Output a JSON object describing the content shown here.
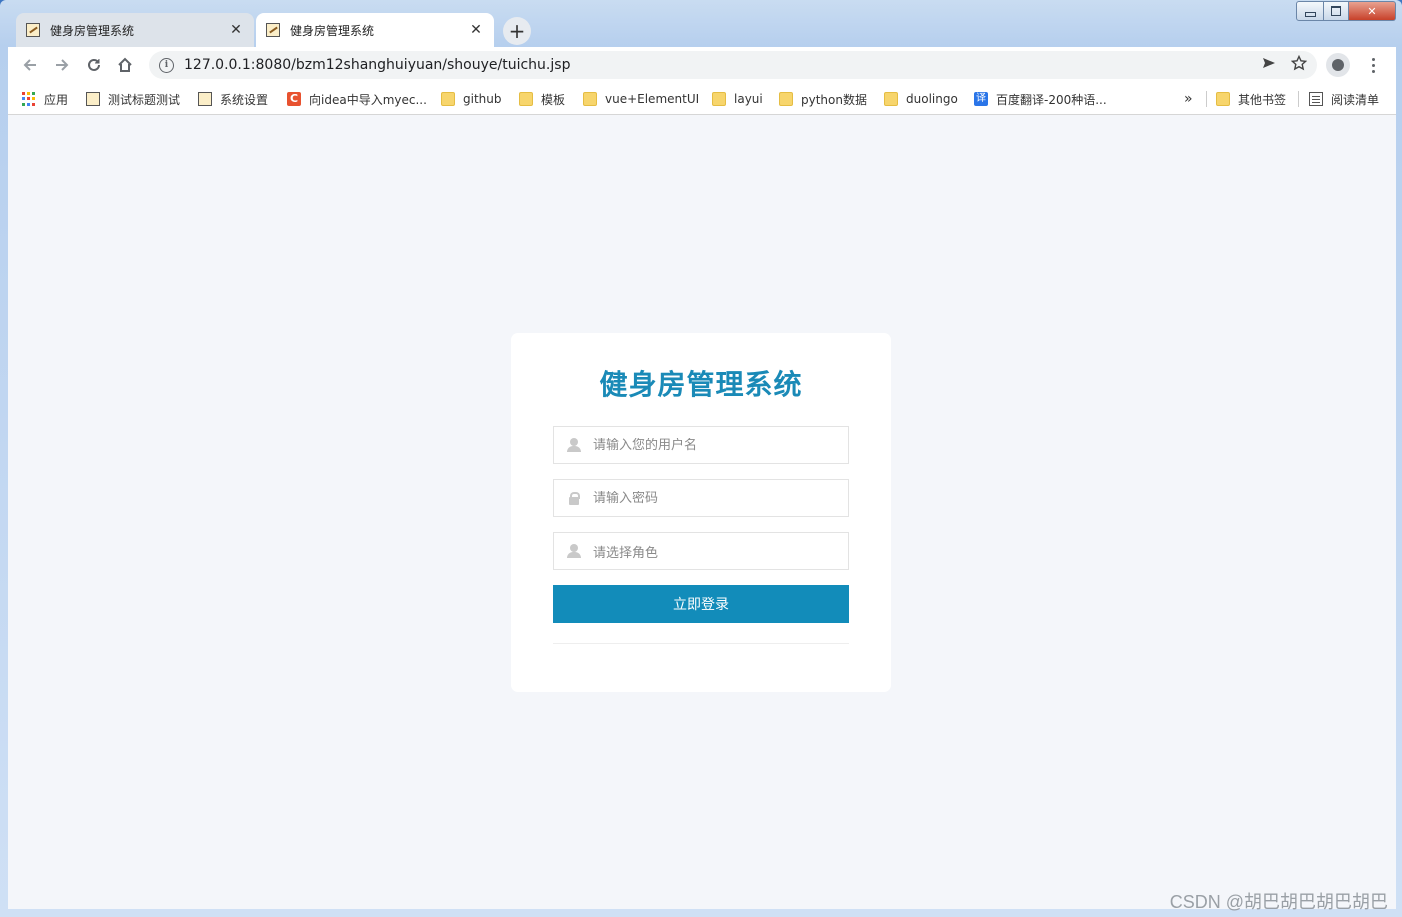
{
  "tabs": [
    {
      "title": "健身房管理系统",
      "close": "✕"
    },
    {
      "title": "健身房管理系统",
      "close": "✕"
    }
  ],
  "new_tab_label": "+",
  "address_bar": {
    "url_host": "127.0.0.1",
    "url_rest": ":8080/bzm12shanghuiyuan/shouye/tuichu.jsp"
  },
  "bookmarks": [
    {
      "label": "应用",
      "icon": "apps-grid-icon"
    },
    {
      "label": "测试标题测试",
      "icon": "page-icon"
    },
    {
      "label": "系统设置",
      "icon": "page-icon"
    },
    {
      "label": "向idea中导入myec...",
      "icon": "csdn-c-icon"
    },
    {
      "label": "github",
      "icon": "folder-icon"
    },
    {
      "label": "模板",
      "icon": "folder-icon"
    },
    {
      "label": "vue+ElementUI",
      "icon": "folder-icon"
    },
    {
      "label": "layui",
      "icon": "folder-icon"
    },
    {
      "label": "python数据",
      "icon": "folder-icon"
    },
    {
      "label": "duolingo",
      "icon": "folder-icon"
    },
    {
      "label": "百度翻译-200种语...",
      "icon": "translate-icon"
    }
  ],
  "bookmarks_overflow": "»",
  "other_bookmarks": "其他书签",
  "reading_list": "阅读清单",
  "login": {
    "title": "健身房管理系统",
    "username_placeholder": "请输入您的用户名",
    "password_placeholder": "请输入密码",
    "role_placeholder": "请选择角色",
    "submit_label": "立即登录"
  },
  "watermark": "CSDN @胡巴胡巴胡巴胡巴",
  "colors": {
    "brand": "#1a8ab7",
    "button": "#128cba",
    "page_bg": "#f4f6fa"
  }
}
